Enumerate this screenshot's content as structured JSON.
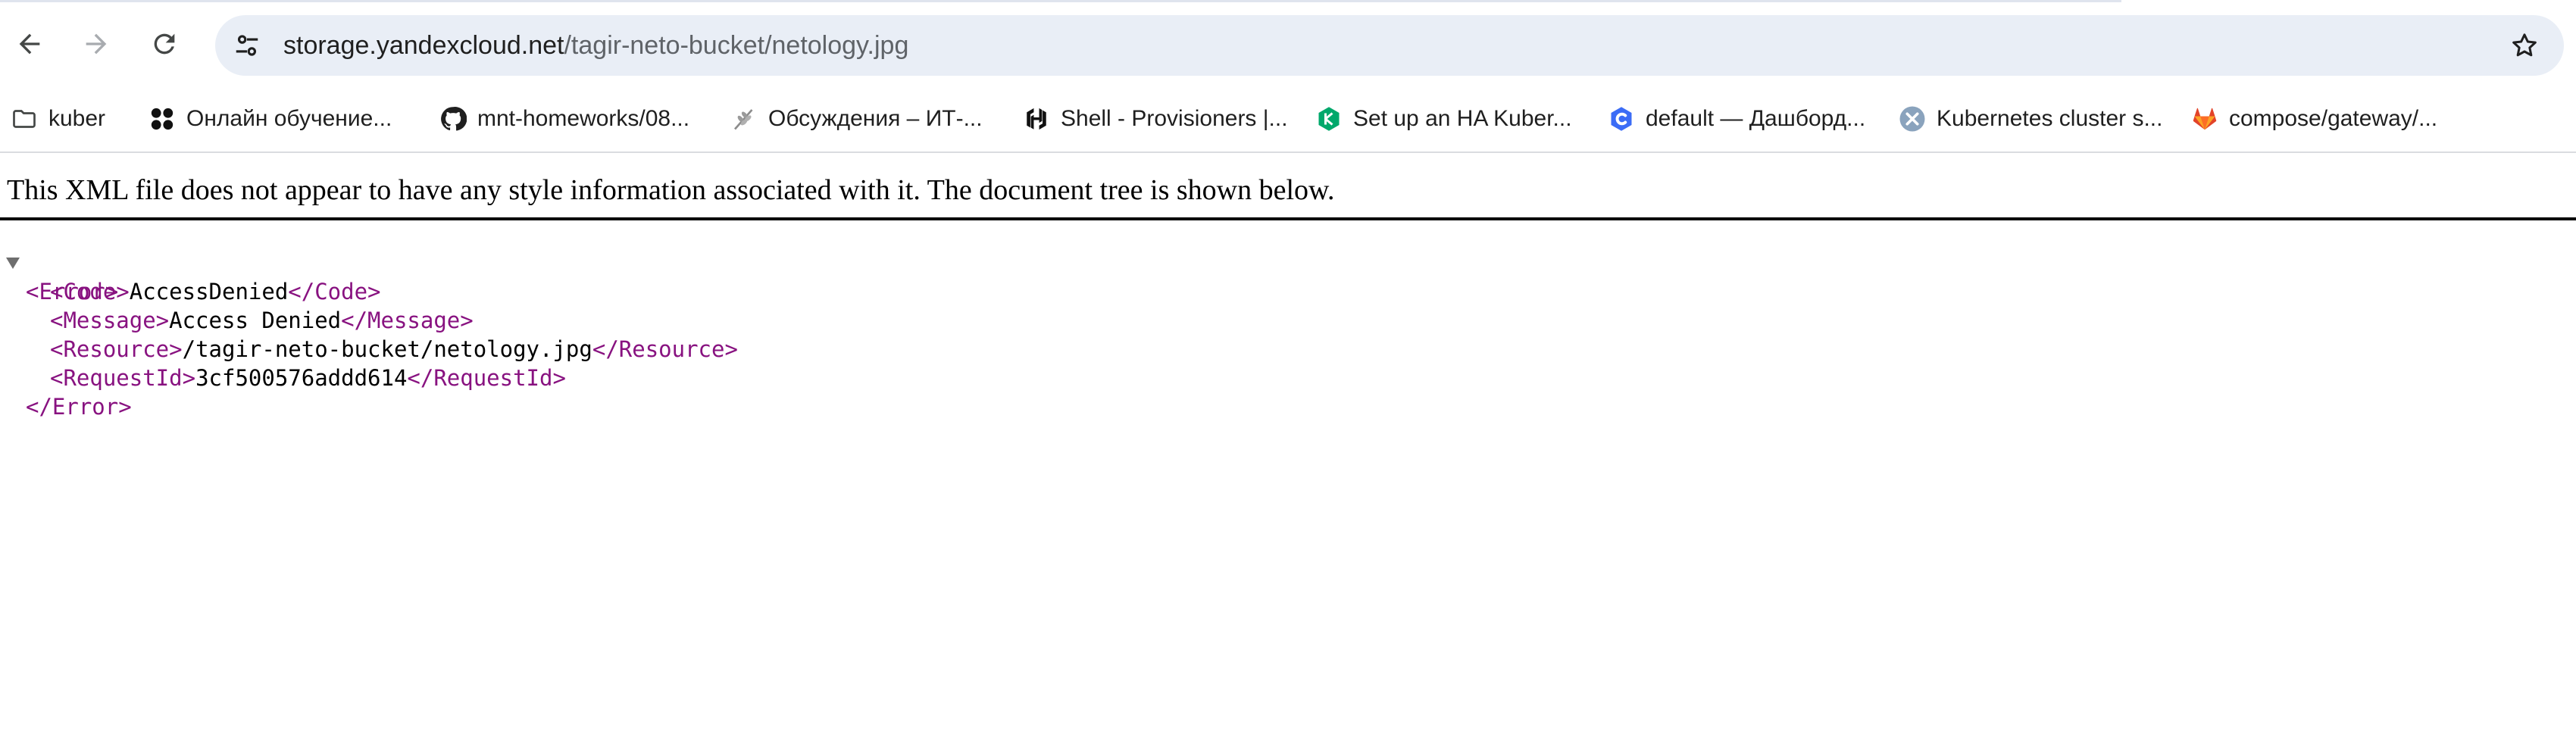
{
  "browser": {
    "back_label": "Back",
    "forward_label": "Forward",
    "reload_label": "Reload",
    "address": {
      "host": "storage.yandexcloud.net",
      "path": "/tagir-neto-bucket/netology.jpg"
    },
    "bookmark_star_label": "Bookmark this tab"
  },
  "bookmarks": [
    {
      "icon": "folder-icon",
      "label": "kuber"
    },
    {
      "icon": "four-dots-logo-icon",
      "label": "Онлайн обучение..."
    },
    {
      "icon": "github-icon",
      "label": "mnt-homeworks/08..."
    },
    {
      "icon": "wheat-icon",
      "label": "Обсуждения – ИТ-..."
    },
    {
      "icon": "hashicorp-icon",
      "label": "Shell - Provisioners |..."
    },
    {
      "icon": "green-hexagon-icon",
      "label": "Set up an HA Kuber..."
    },
    {
      "icon": "blue-c-logo-icon",
      "label": "default — Дашборд..."
    },
    {
      "icon": "rancher-wrench-icon",
      "label": "Kubernetes cluster s..."
    },
    {
      "icon": "gitlab-icon",
      "label": "compose/gateway/..."
    }
  ],
  "page": {
    "notice": "This XML file does not appear to have any style information associated with it. The document tree is shown below.",
    "xml": {
      "root_open": "<Error>",
      "root_close": "</Error>",
      "elements": [
        {
          "open": "<Code>",
          "text": "AccessDenied",
          "close": "</Code>"
        },
        {
          "open": "<Message>",
          "text": "Access Denied",
          "close": "</Message>"
        },
        {
          "open": "<Resource>",
          "text": "/tagir-neto-bucket/netology.jpg",
          "close": "</Resource>"
        },
        {
          "open": "<RequestId>",
          "text": "3cf500576addd614",
          "close": "</RequestId>"
        }
      ]
    }
  },
  "colors": {
    "xml_tag": "#881280",
    "omnibox_bg": "#e9eef6",
    "github": "#1f1f1f",
    "gitlab": "#e24329",
    "green_hex": "#00a86b",
    "blue_logo": "#3b6cf6",
    "rancher": "#8aa3bd"
  }
}
